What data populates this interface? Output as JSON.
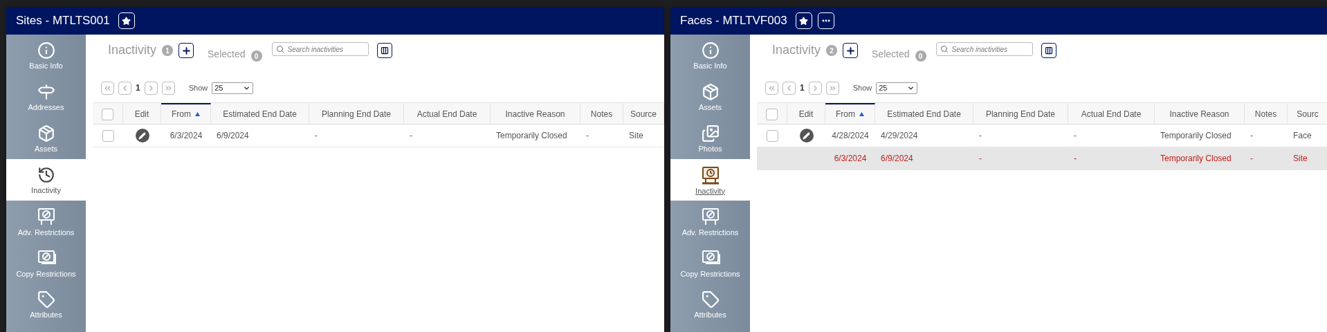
{
  "panels": [
    {
      "title": "Sites - MTLTS001",
      "title_buttons": [
        {
          "kind": "star"
        }
      ],
      "sidebar": [
        {
          "label": "Basic Info",
          "kind": "info",
          "selected": false
        },
        {
          "label": "Addresses",
          "kind": "signpost",
          "selected": false
        },
        {
          "label": "Assets",
          "kind": "box",
          "selected": false
        },
        {
          "label": "Inactivity",
          "kind": "history",
          "selected": true
        },
        {
          "label": "Adv. Restrictions",
          "kind": "board-ban",
          "selected": false
        },
        {
          "label": "Copy Restrictions",
          "kind": "photo-ban",
          "selected": false
        },
        {
          "label": "Attributes",
          "kind": "tag",
          "selected": false
        }
      ],
      "heading": {
        "title": "Inactivity",
        "count": "1",
        "selected_label": "Selected",
        "selected_count": "0",
        "search_placeholder": "Search inactivities"
      },
      "pager": {
        "page": "1",
        "show_label": "Show",
        "page_size": "25"
      },
      "columns": [
        {
          "kind": "checkbox",
          "checked": false
        },
        {
          "label": "Edit",
          "sorted": false
        },
        {
          "label": "From",
          "sorted": true
        },
        {
          "label": "Estimated End Date",
          "sorted": false
        },
        {
          "label": "Planning End Date",
          "sorted": false
        },
        {
          "label": "Actual End Date",
          "sorted": false
        },
        {
          "label": "Inactive Reason",
          "sorted": false
        },
        {
          "label": "Notes",
          "sorted": false
        },
        {
          "label": "Source",
          "sorted": false
        }
      ],
      "rows": [
        {
          "kind": "own",
          "checked": false,
          "cells": [
            "",
            "",
            "6/3/2024",
            "6/9/2024",
            "-",
            "-",
            "Temporarily Closed",
            "-",
            "Site"
          ]
        }
      ]
    },
    {
      "title": "Faces - MTLTVF003",
      "title_buttons": [
        {
          "kind": "star"
        },
        {
          "kind": "more"
        }
      ],
      "sidebar": [
        {
          "label": "Basic Info",
          "kind": "info",
          "selected": false
        },
        {
          "label": "Assets",
          "kind": "box",
          "selected": false
        },
        {
          "label": "Photos",
          "kind": "photos",
          "selected": false
        },
        {
          "label": "Inactivity",
          "kind": "board-clock",
          "selected": true
        },
        {
          "label": "Adv. Restrictions",
          "kind": "board-ban",
          "selected": false
        },
        {
          "label": "Copy Restrictions",
          "kind": "photo-ban",
          "selected": false
        },
        {
          "label": "Attributes",
          "kind": "tag",
          "selected": false
        }
      ],
      "heading": {
        "title": "Inactivity",
        "count": "2",
        "selected_label": "Selected",
        "selected_count": "0",
        "search_placeholder": "Search inactivities"
      },
      "pager": {
        "page": "1",
        "show_label": "Show",
        "page_size": "25"
      },
      "columns": [
        {
          "kind": "checkbox",
          "checked": false
        },
        {
          "label": "Edit",
          "sorted": false
        },
        {
          "label": "From",
          "sorted": true
        },
        {
          "label": "Estimated End Date",
          "sorted": false
        },
        {
          "label": "Planning End Date",
          "sorted": false
        },
        {
          "label": "Actual End Date",
          "sorted": false
        },
        {
          "label": "Inactive Reason",
          "sorted": false
        },
        {
          "label": "Notes",
          "sorted": false
        },
        {
          "label": "Sourc",
          "sorted": false
        }
      ],
      "rows": [
        {
          "kind": "own",
          "checked": false,
          "cells": [
            "",
            "",
            "4/28/2024",
            "4/29/2024",
            "-",
            "-",
            "Temporarily Closed",
            "-",
            "Face"
          ]
        },
        {
          "kind": "inherited",
          "checked": false,
          "cells": [
            "",
            "",
            "6/3/2024",
            "6/9/2024",
            "-",
            "-",
            "Temporarily Closed",
            "-",
            "Site"
          ]
        }
      ]
    }
  ]
}
